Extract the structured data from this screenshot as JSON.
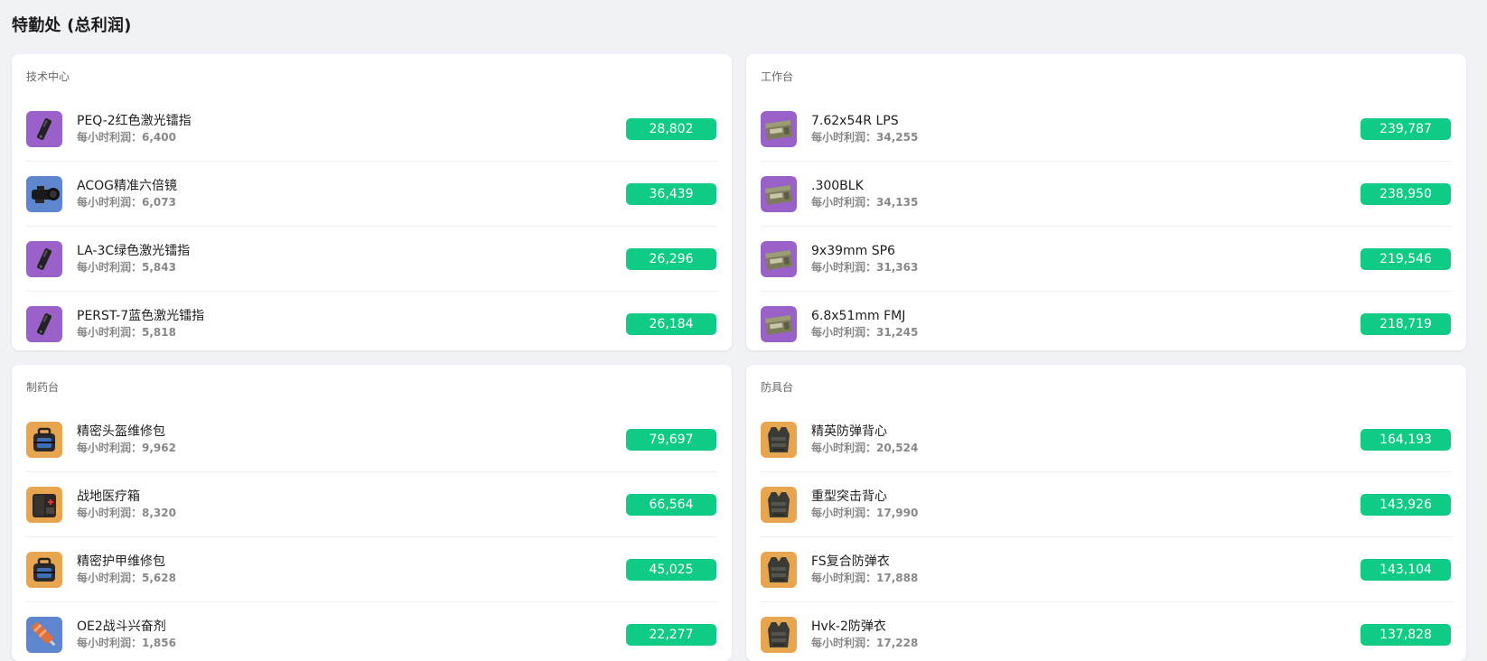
{
  "page": {
    "title": "特勤处 (总利润)"
  },
  "hourly_label": "每小时利润：",
  "colors": {
    "badge": "#0fcb85",
    "purple": "#9a62c8",
    "blue": "#5d86cf",
    "orange": "#e8a550"
  },
  "panels": [
    {
      "title": "技术中心",
      "items": [
        {
          "name": "PEQ-2红色激光镭指",
          "hourly": "6,400",
          "total": "28,802",
          "icon": "laser-icon",
          "bg": "purple"
        },
        {
          "name": "ACOG精准六倍镜",
          "hourly": "6,073",
          "total": "36,439",
          "icon": "scope-icon",
          "bg": "blue"
        },
        {
          "name": "LA-3C绿色激光镭指",
          "hourly": "5,843",
          "total": "26,296",
          "icon": "laser-icon",
          "bg": "purple"
        },
        {
          "name": "PERST-7蓝色激光镭指",
          "hourly": "5,818",
          "total": "26,184",
          "icon": "laser-icon",
          "bg": "purple"
        }
      ]
    },
    {
      "title": "工作台",
      "items": [
        {
          "name": "7.62x54R LPS",
          "hourly": "34,255",
          "total": "239,787",
          "icon": "ammo-box-icon",
          "bg": "purple"
        },
        {
          "name": ".300BLK",
          "hourly": "34,135",
          "total": "238,950",
          "icon": "ammo-box-icon",
          "bg": "purple"
        },
        {
          "name": "9x39mm SP6",
          "hourly": "31,363",
          "total": "219,546",
          "icon": "ammo-box-icon",
          "bg": "purple"
        },
        {
          "name": "6.8x51mm FMJ",
          "hourly": "31,245",
          "total": "218,719",
          "icon": "ammo-box-icon",
          "bg": "purple"
        }
      ]
    },
    {
      "title": "制药台",
      "items": [
        {
          "name": "精密头盔维修包",
          "hourly": "9,962",
          "total": "79,697",
          "icon": "repair-kit-icon",
          "bg": "orange"
        },
        {
          "name": "战地医疗箱",
          "hourly": "8,320",
          "total": "66,564",
          "icon": "medkit-icon",
          "bg": "orange"
        },
        {
          "name": "精密护甲维修包",
          "hourly": "5,628",
          "total": "45,025",
          "icon": "repair-kit-icon",
          "bg": "orange"
        },
        {
          "name": "OE2战斗兴奋剂",
          "hourly": "1,856",
          "total": "22,277",
          "icon": "syringe-icon",
          "bg": "blue"
        }
      ]
    },
    {
      "title": "防具台",
      "items": [
        {
          "name": "精英防弹背心",
          "hourly": "20,524",
          "total": "164,193",
          "icon": "vest-icon",
          "bg": "orange"
        },
        {
          "name": "重型突击背心",
          "hourly": "17,990",
          "total": "143,926",
          "icon": "vest-icon",
          "bg": "orange"
        },
        {
          "name": "FS复合防弹衣",
          "hourly": "17,888",
          "total": "143,104",
          "icon": "vest-icon",
          "bg": "orange"
        },
        {
          "name": "Hvk-2防弹衣",
          "hourly": "17,228",
          "total": "137,828",
          "icon": "vest-icon",
          "bg": "orange"
        }
      ]
    }
  ]
}
